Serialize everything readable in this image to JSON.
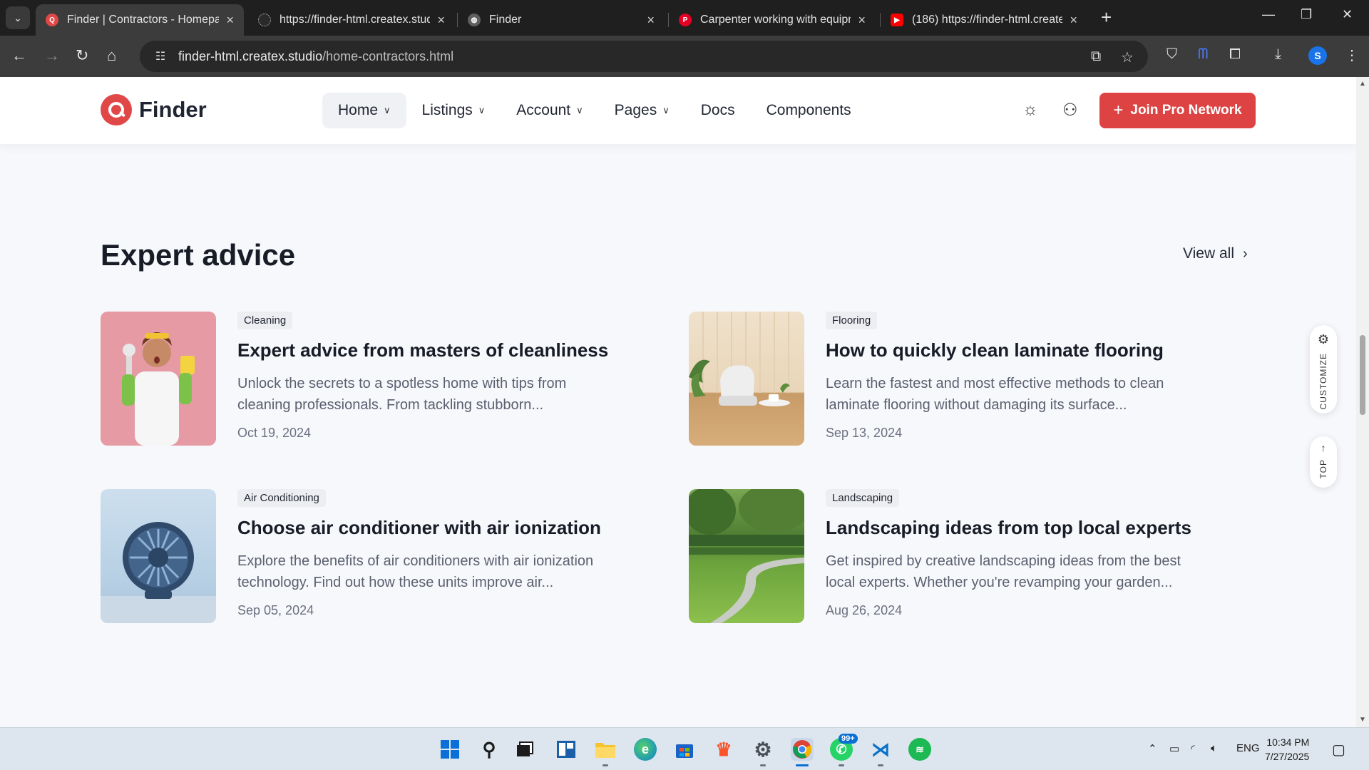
{
  "browser": {
    "tabs": [
      {
        "title": "Finder | Contractors - Homepag",
        "favicon": "finder-logo-icon",
        "active": true
      },
      {
        "title": "https://finder-html.createx.stud",
        "favicon": "createx-icon",
        "active": false
      },
      {
        "title": "Finder",
        "favicon": "globe-icon",
        "active": false
      },
      {
        "title": "Carpenter working with equipm",
        "favicon": "pinterest-icon",
        "active": false
      },
      {
        "title": "(186) https://finder-html.create",
        "favicon": "youtube-icon",
        "active": false
      }
    ],
    "url_host": "finder-html.createx.studio",
    "url_path": "/home-contractors.html",
    "profile_initial": "S"
  },
  "site": {
    "logo_text": "Finder",
    "menu": [
      {
        "label": "Home",
        "dropdown": true,
        "active": true
      },
      {
        "label": "Listings",
        "dropdown": true,
        "active": false
      },
      {
        "label": "Account",
        "dropdown": true,
        "active": false
      },
      {
        "label": "Pages",
        "dropdown": true,
        "active": false
      },
      {
        "label": "Docs",
        "dropdown": false,
        "active": false
      },
      {
        "label": "Components",
        "dropdown": false,
        "active": false
      }
    ],
    "cta_label": "Join Pro Network",
    "accent_color": "#dd4343"
  },
  "section": {
    "title": "Expert advice",
    "view_all": "View all"
  },
  "articles": [
    {
      "tag": "Cleaning",
      "title": "Expert advice from masters of cleanliness",
      "desc_1": "Unlock the secrets to a spotless home with tips from",
      "desc_2": "cleaning professionals. From tackling stubborn...",
      "date": "Oct 19, 2024"
    },
    {
      "tag": "Flooring",
      "title": "How to quickly clean laminate flooring",
      "desc_1": "Learn the fastest and most effective methods to clean",
      "desc_2": "laminate flooring without damaging its surface...",
      "date": "Sep 13, 2024"
    },
    {
      "tag": "Air Conditioning",
      "title": "Choose air conditioner with air ionization",
      "desc_1": "Explore the benefits of air conditioners with air ionization",
      "desc_2": "technology. Find out how these units improve air...",
      "date": "Sep 05, 2024"
    },
    {
      "tag": "Landscaping",
      "title": "Landscaping ideas from top local experts",
      "desc_1": "Get inspired by creative landscaping ideas from the best",
      "desc_2": "local experts. Whether you're revamping your garden...",
      "date": "Aug 26, 2024"
    }
  ],
  "side": {
    "customize_label": "CUSTOMIZE",
    "top_label": "TOP"
  },
  "taskbar": {
    "whatsapp_badge": "99+",
    "language": "ENG",
    "time": "10:34 PM",
    "date": "7/27/2025"
  }
}
